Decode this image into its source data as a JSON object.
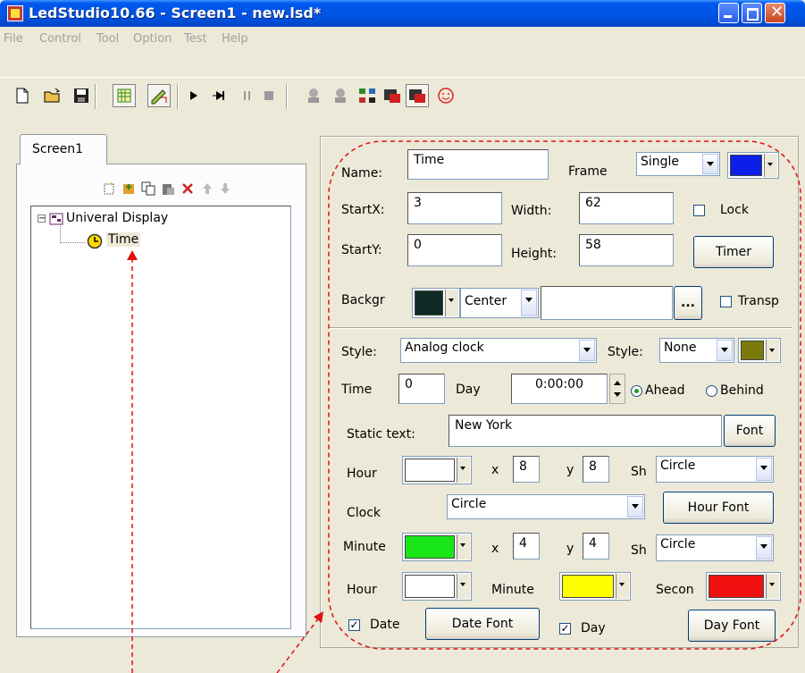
{
  "window": {
    "title": "LedStudio10.66 - Screen1 - new.lsd*"
  },
  "menu": [
    "File",
    "Control",
    "Tool",
    "Option",
    "Test",
    "Help"
  ],
  "tabs": {
    "screen1": "Screen1"
  },
  "tree": {
    "root": "Univeral Display",
    "child": "Time"
  },
  "form": {
    "name_label": "Name:",
    "name_value": "Time",
    "frame_label": "Frame",
    "frame_value": "Single",
    "startx_label": "StartX:",
    "startx_value": "3",
    "width_label": "Width:",
    "width_value": "62",
    "lock_label": "Lock",
    "starty_label": "StartY:",
    "starty_value": "0",
    "height_label": "Height:",
    "height_value": "58",
    "timer_button": "Timer",
    "backgr_label": "Backgr",
    "align_value": "Center",
    "ellipsis": "...",
    "transp_label": "Transp",
    "style_label": "Style:",
    "style_value": "Analog clock",
    "style2_label": "Style:",
    "style2_value": "None",
    "time_label": "Time",
    "time_value": "0",
    "day_label": "Day",
    "day_value": "0:00:00",
    "ahead_label": "Ahead",
    "behind_label": "Behind",
    "static_text_label": "Static text:",
    "static_text_value": "New York",
    "font_button": "Font",
    "hour_label": "Hour",
    "x_label": "x",
    "hour_x": "8",
    "y_label": "y",
    "hour_y": "8",
    "sh_label": "Sh",
    "hour_shape": "Circle",
    "clock_label": "Clock",
    "clock_value": "Circle",
    "hour_font_button": "Hour Font",
    "minute_label": "Minute",
    "minute_x": "4",
    "minute_y": "4",
    "minute_shape": "Circle",
    "hour2_label": "Hour",
    "minute2_label": "Minute",
    "second_label": "Secon",
    "date_label": "Date",
    "date_font_button": "Date Font",
    "day_check_label": "Day",
    "day_font_button": "Day Font"
  },
  "colors": {
    "frame": "#0b1fe8",
    "background": "#0d2a24",
    "style": "#7c7a0c",
    "hour": "#ffffff",
    "minute": "#19e619",
    "hour2": "#ffffff",
    "minute2": "#ffff00",
    "second": "#f01010",
    "annotation": "#e01010"
  },
  "icons": [
    "new-file-icon",
    "open-folder-icon",
    "save-icon",
    "grid-icon",
    "edit-icon",
    "play-icon",
    "step-icon",
    "pause-icon",
    "stop-icon",
    "person-icon",
    "person2-icon",
    "network-icon",
    "screen-red-icon",
    "screen-blue-icon",
    "smiley-icon"
  ]
}
